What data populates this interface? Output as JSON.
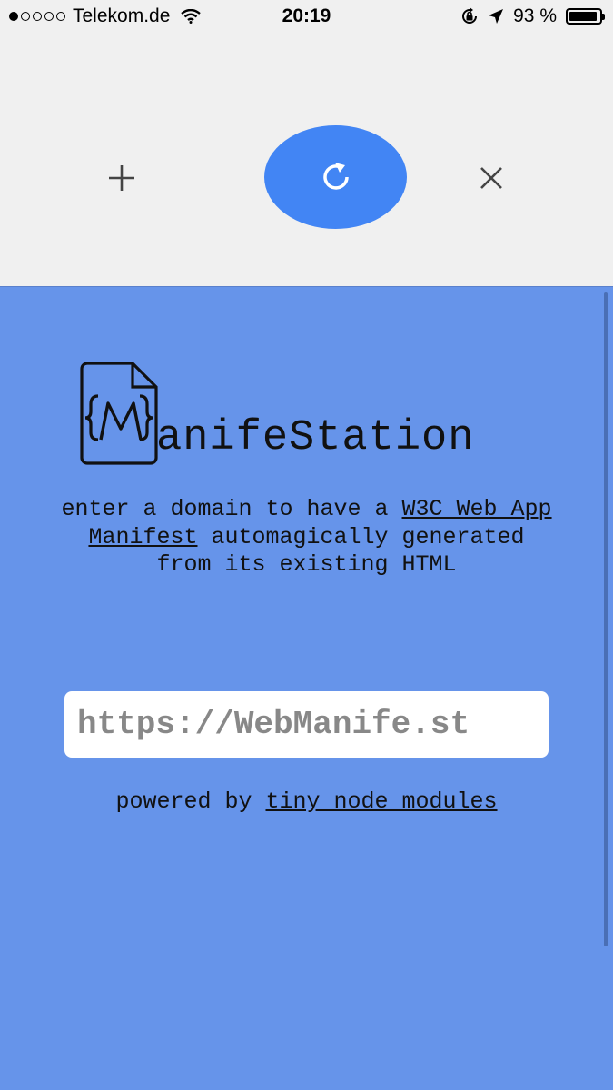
{
  "status_bar": {
    "carrier": "Telekom.de",
    "time": "20:19",
    "battery_percent": "93 %",
    "battery_level": 0.93,
    "signal_bars_filled": 1,
    "signal_bars_total": 5
  },
  "toolbar": {
    "add_icon": "plus-icon",
    "reload_icon": "refresh-icon",
    "close_icon": "close-icon",
    "accent_color": "#4285f4"
  },
  "page": {
    "background_color": "#6694ea",
    "logo_text": "anifeStation",
    "logo_letter": "M",
    "tagline_before": "enter a domain to have a ",
    "tagline_link": "W3C Web App Manifest",
    "tagline_after": " automagically generated from its existing HTML",
    "url_input_value": "https://WebManife.st",
    "powered_before": "powered by ",
    "powered_link": "tiny node modules"
  }
}
